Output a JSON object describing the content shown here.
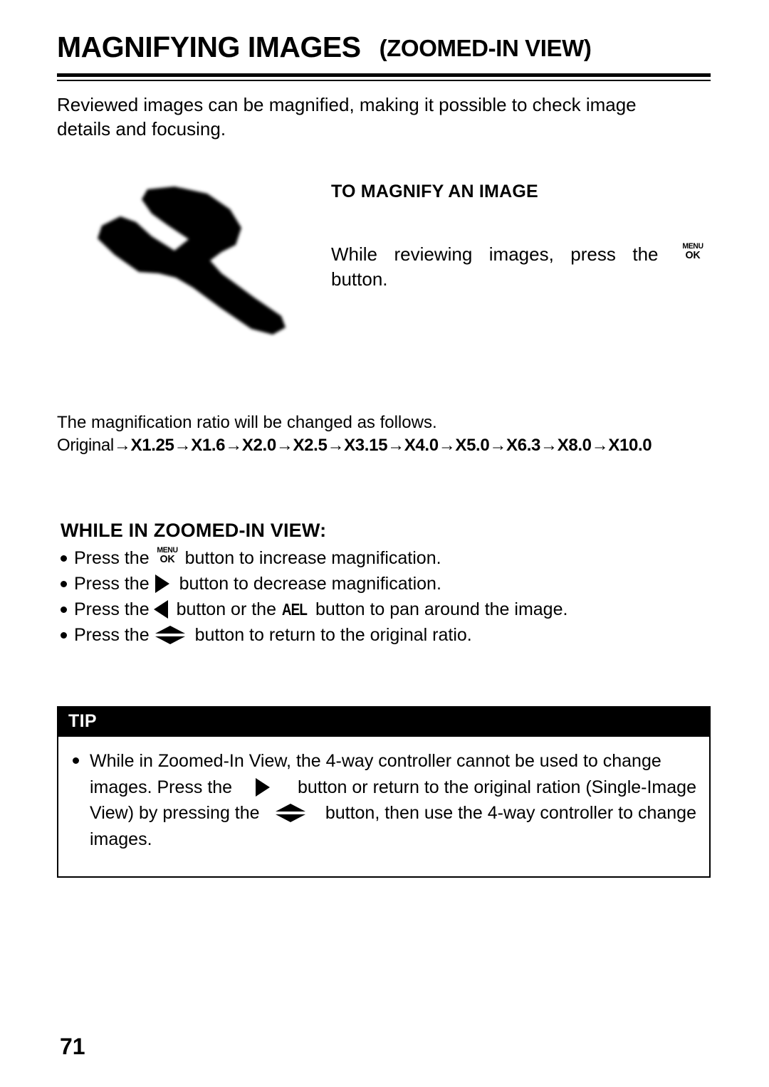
{
  "header": {
    "title_main": "MAGNIFYING IMAGES",
    "title_sub": "(ZOOMED-IN VIEW)"
  },
  "intro": {
    "line1": "Reviewed images can be magnified, making it possible to check image",
    "line2": "details and focusing."
  },
  "illustration": {
    "name": "wrench-icon",
    "alt": "blurred wrench illustration"
  },
  "to_magnify": {
    "heading": "TO MAGNIFY AN IMAGE",
    "line1_a": "While",
    "line1_b": "reviewing",
    "line1_c": "images,",
    "line1_d": "press",
    "line1_e": "the",
    "line2": "button."
  },
  "ratio": {
    "intro": "The magnification ratio will be changed as follows.",
    "original_label": "Original",
    "arrow": "→",
    "steps": [
      "X1.25",
      "X1.6",
      "X2.0",
      "X2.5",
      "X3.15",
      "X4.0",
      "X5.0",
      "X6.3",
      "X8.0",
      "X10.0"
    ]
  },
  "while_zoomed": {
    "heading": "WHILE IN ZOOMED-IN VIEW:",
    "items": [
      {
        "pre": "Press the",
        "icon": "menu-ok-icon",
        "post": "button to increase magnification."
      },
      {
        "pre": "Press the",
        "icon": "triangle-right-icon",
        "post": "button to decrease magnification."
      },
      {
        "pre": "Press the",
        "icon": "triangle-left-icon",
        "mid": "button or the",
        "icon2": "ael-icon",
        "post": "button to pan around the image."
      },
      {
        "pre": "Press the",
        "icon": "up-down-arrow-icon",
        "post": "button to return to the original ratio."
      }
    ]
  },
  "tip": {
    "header": "TIP",
    "line1": "While in Zoomed-In View, the 4-way controller cannot be used to change",
    "line2_a": "images.  Press the",
    "line2_b": "button or return to the original ration (Single-Image",
    "line3_a": "View) by pressing the",
    "line3_b": "button, then use the 4-way controller to change",
    "line4": "images."
  },
  "icons": {
    "menu_top": "MENU",
    "menu_bottom": "OK",
    "ael": "AEL"
  },
  "footer": {
    "page_number": "71"
  },
  "colors": {
    "ink": "#000000",
    "paper": "#ffffff"
  }
}
